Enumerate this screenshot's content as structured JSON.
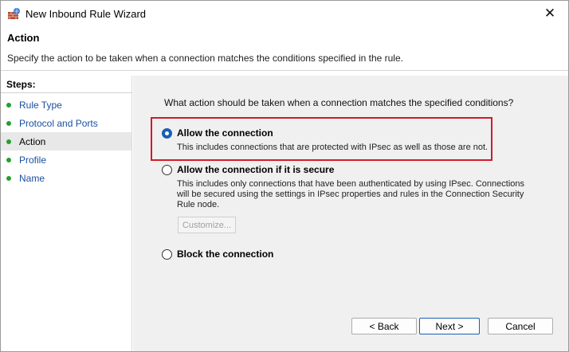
{
  "window": {
    "title": "New Inbound Rule Wizard",
    "close_glyph": "✕"
  },
  "header": {
    "title": "Action",
    "description": "Specify the action to be taken when a connection matches the conditions specified in the rule."
  },
  "steps": {
    "heading": "Steps:",
    "items": [
      {
        "label": "Rule Type",
        "active": false
      },
      {
        "label": "Protocol and Ports",
        "active": false
      },
      {
        "label": "Action",
        "active": true
      },
      {
        "label": "Profile",
        "active": false
      },
      {
        "label": "Name",
        "active": false
      }
    ]
  },
  "main": {
    "question": "What action should be taken when a connection matches the specified conditions?",
    "options": [
      {
        "label": "Allow the connection",
        "selected": true,
        "description": "This includes connections that are protected with IPsec as well as those are not."
      },
      {
        "label": "Allow the connection if it is secure",
        "selected": false,
        "description_line1": "This includes only connections that have been authenticated by using IPsec.  Connections",
        "description_line2": "will be secured using the settings in IPsec properties and rules in the Connection Security",
        "description_line3": "Rule node."
      },
      {
        "label": "Block the connection",
        "selected": false
      }
    ],
    "customize_label": "Customize..."
  },
  "footer": {
    "back_label": "< Back",
    "next_label": "Next >",
    "cancel_label": "Cancel"
  },
  "colors": {
    "highlight": "#d11a2a",
    "step_dot": "#22a12c",
    "link": "#1a4fa0",
    "selected_radio": "#1a5fb4"
  }
}
